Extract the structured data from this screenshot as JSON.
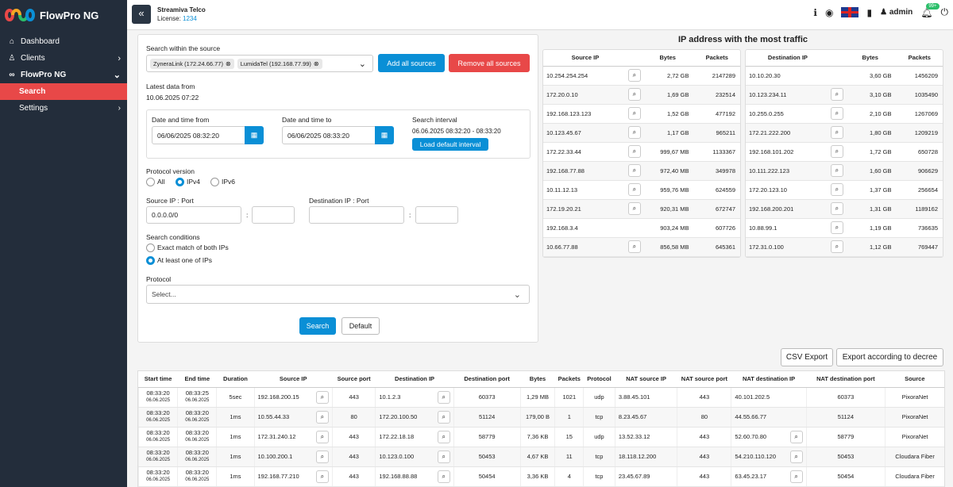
{
  "app": {
    "title": "FlowPro NG"
  },
  "sidebar": {
    "items": [
      {
        "label": "Dashboard",
        "icon": "dashboard-icon"
      },
      {
        "label": "Clients",
        "icon": "user-icon"
      },
      {
        "label": "FlowPro NG",
        "icon": "infinity-icon"
      }
    ],
    "sub": [
      {
        "label": "Search"
      },
      {
        "label": "Settings"
      }
    ]
  },
  "header": {
    "company": "Streamiva Telco",
    "license_label": "License:",
    "license_num": "1234",
    "user": "admin",
    "notif_badge": "99+"
  },
  "form": {
    "search_within": "Search within the source",
    "chips": [
      "ZyneraLink (172.24.66.77)",
      "LumidaTel (192.168.77.99)"
    ],
    "add_all": "Add all sources",
    "remove_all": "Remove all sources",
    "latest_label": "Latest data from",
    "latest_value": "10.06.2025 07:22",
    "dt_from_label": "Date and time from",
    "dt_from_value": "06/06/2025 08:32:20",
    "dt_to_label": "Date and time to",
    "dt_to_value": "06/06/2025 08:33:20",
    "interval_label": "Search interval",
    "interval_value": "06.06.2025 08:32:20 - 08:33:20",
    "load_default": "Load default interval",
    "protocol_version": "Protocol version",
    "pv_all": "All",
    "pv_ipv4": "IPv4",
    "pv_ipv6": "IPv6",
    "src_label": "Source IP : Port",
    "src_value": "0.0.0.0/0",
    "dst_label": "Destination IP : Port",
    "conditions_label": "Search conditions",
    "cond_exact": "Exact match of both IPs",
    "cond_one": "At least one of IPs",
    "protocol_label": "Protocol",
    "protocol_placeholder": "Select...",
    "search": "Search",
    "default": "Default",
    "colon": ":"
  },
  "traffic": {
    "title": "IP address with the most traffic",
    "src_headers": [
      "Source IP",
      "Bytes",
      "Packets"
    ],
    "src_rows": [
      [
        "10.254.254.254",
        "2,72 GB",
        "2147289"
      ],
      [
        "172.20.0.10",
        "1,69 GB",
        "232514"
      ],
      [
        "192.168.123.123",
        "1,52 GB",
        "477192"
      ],
      [
        "10.123.45.67",
        "1,17 GB",
        "965211"
      ],
      [
        "172.22.33.44",
        "999,67 MB",
        "1133367"
      ],
      [
        "192.168.77.88",
        "972,40 MB",
        "349978"
      ],
      [
        "10.11.12.13",
        "959,76 MB",
        "624559"
      ],
      [
        "172.19.20.21",
        "920,31 MB",
        "672747"
      ],
      [
        "192.168.3.4",
        "903,24 MB",
        "607726"
      ],
      [
        "10.66.77.88",
        "856,58 MB",
        "645361"
      ]
    ],
    "src_mag": [
      true,
      true,
      true,
      true,
      true,
      true,
      true,
      true,
      false,
      true
    ],
    "dst_headers": [
      "Destination IP",
      "Bytes",
      "Packets"
    ],
    "dst_rows": [
      [
        "10.10.20.30",
        "3,60 GB",
        "1456209"
      ],
      [
        "10.123.234.11",
        "3,10 GB",
        "1035490"
      ],
      [
        "10.255.0.255",
        "2,10 GB",
        "1267069"
      ],
      [
        "172.21.222.200",
        "1,80 GB",
        "1209219"
      ],
      [
        "192.168.101.202",
        "1,72 GB",
        "650728"
      ],
      [
        "10.111.222.123",
        "1,60 GB",
        "906629"
      ],
      [
        "172.20.123.10",
        "1,37 GB",
        "256654"
      ],
      [
        "192.168.200.201",
        "1,31 GB",
        "1189162"
      ],
      [
        "10.88.99.1",
        "1,19 GB",
        "736635"
      ],
      [
        "172.31.0.100",
        "1,12 GB",
        "769447"
      ]
    ],
    "dst_mag": [
      false,
      true,
      true,
      true,
      true,
      true,
      true,
      true,
      true,
      true
    ]
  },
  "export": {
    "csv": "CSV Export",
    "decree": "Export according to decree"
  },
  "flows": {
    "headers": [
      "Start time",
      "End time",
      "Duration",
      "Source IP",
      "Source port",
      "Destination IP",
      "Destination port",
      "Bytes",
      "Packets",
      "Protocol",
      "NAT source IP",
      "NAT source port",
      "NAT destination IP",
      "NAT destination port",
      "Source"
    ],
    "rows": [
      {
        "st": "08:33:20",
        "sd": "06.06.2025",
        "et": "08:33:25",
        "ed": "06.06.2025",
        "dur": "5sec",
        "src": "192.168.200.15",
        "sp": "443",
        "dst": "10.1.2.3",
        "dp": "60373",
        "bytes": "1,29 MB",
        "pk": "1021",
        "proto": "udp",
        "nsrc": "3.88.45.101",
        "nsp": "443",
        "ndst": "40.101.202.5",
        "ndp": "60373",
        "source": "PixoraNet",
        "ndmag": false
      },
      {
        "st": "08:33:20",
        "sd": "06.06.2025",
        "et": "08:33:20",
        "ed": "06.06.2025",
        "dur": "1ms",
        "src": "10.55.44.33",
        "sp": "80",
        "dst": "172.20.100.50",
        "dp": "51124",
        "bytes": "179,00 B",
        "pk": "1",
        "proto": "tcp",
        "nsrc": "8.23.45.67",
        "nsp": "80",
        "ndst": "44.55.66.77",
        "ndp": "51124",
        "source": "PixoraNet",
        "ndmag": false
      },
      {
        "st": "08:33:20",
        "sd": "06.06.2025",
        "et": "08:33:20",
        "ed": "06.06.2025",
        "dur": "1ms",
        "src": "172.31.240.12",
        "sp": "443",
        "dst": "172.22.18.18",
        "dp": "58779",
        "bytes": "7,36 KB",
        "pk": "15",
        "proto": "udp",
        "nsrc": "13.52.33.12",
        "nsp": "443",
        "ndst": "52.60.70.80",
        "ndp": "58779",
        "source": "PixoraNet",
        "ndmag": true
      },
      {
        "st": "08:33:20",
        "sd": "06.06.2025",
        "et": "08:33:20",
        "ed": "06.06.2025",
        "dur": "1ms",
        "src": "10.100.200.1",
        "sp": "443",
        "dst": "10.123.0.100",
        "dp": "50453",
        "bytes": "4,67 KB",
        "pk": "11",
        "proto": "tcp",
        "nsrc": "18.118.12.200",
        "nsp": "443",
        "ndst": "54.210.110.120",
        "ndp": "50453",
        "source": "Cloudara Fiber",
        "ndmag": true
      },
      {
        "st": "08:33:20",
        "sd": "06.06.2025",
        "et": "08:33:20",
        "ed": "06.06.2025",
        "dur": "1ms",
        "src": "192.168.77.210",
        "sp": "443",
        "dst": "192.168.88.88",
        "dp": "50454",
        "bytes": "3,36 KB",
        "pk": "4",
        "proto": "tcp",
        "nsrc": "23.45.67.89",
        "nsp": "443",
        "ndst": "63.45.23.17",
        "ndp": "50454",
        "source": "Cloudara Fiber",
        "ndmag": true
      }
    ]
  }
}
